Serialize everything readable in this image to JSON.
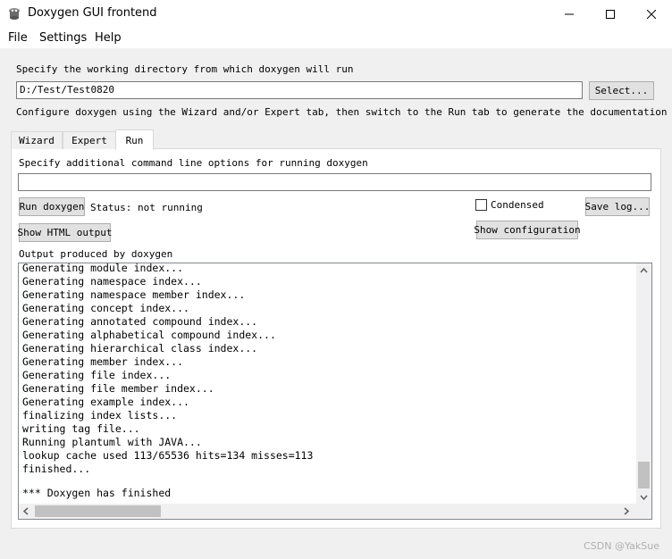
{
  "window": {
    "title": "Doxygen GUI frontend",
    "controls": {
      "minimize": "—",
      "maximize": "☐",
      "close": "✕"
    }
  },
  "menu": {
    "file": "File",
    "settings": "Settings",
    "help": "Help"
  },
  "workdir": {
    "label": "Specify the working directory from which doxygen will run",
    "value": "D:/Test/Test0820",
    "select_button": "Select..."
  },
  "instructions": "Configure doxygen using the Wizard and/or Expert tab, then switch to the Run tab to generate the documentation",
  "tabs": [
    {
      "label": "Wizard",
      "active": false
    },
    {
      "label": "Expert",
      "active": false
    },
    {
      "label": "Run",
      "active": true
    }
  ],
  "run": {
    "options_label": "Specify additional command line options for running doxygen",
    "options_value": "",
    "run_button": "Run doxygen",
    "status": "Status: not running",
    "condensed_label": "Condensed",
    "condensed_checked": false,
    "save_log_button": "Save log...",
    "show_html_button": "Show HTML output",
    "show_config_button": "Show configuration",
    "output_label": "Output produced by doxygen"
  },
  "log_lines": [
    "Generating module index...",
    "Generating namespace index...",
    "Generating namespace member index...",
    "Generating concept index...",
    "Generating annotated compound index...",
    "Generating alphabetical compound index...",
    "Generating hierarchical class index...",
    "Generating member index...",
    "Generating file index...",
    "Generating file member index...",
    "Generating example index...",
    "finalizing index lists...",
    "writing tag file...",
    "Running plantuml with JAVA...",
    "lookup cache used 113/65536 hits=134 misses=113",
    "finished...",
    "",
    "*** Doxygen has finished"
  ],
  "watermark": "CSDN @YakSue"
}
